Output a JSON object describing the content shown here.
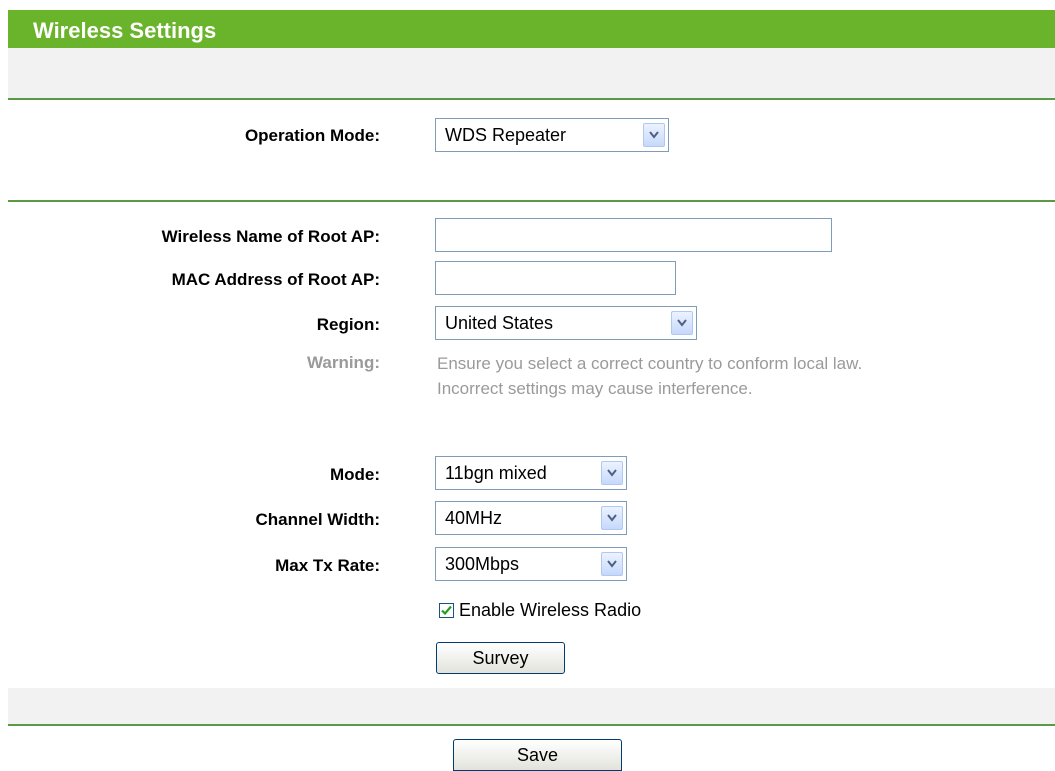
{
  "header": {
    "title": "Wireless Settings"
  },
  "operation_mode": {
    "label": "Operation Mode:",
    "value": "WDS Repeater"
  },
  "root_ap_name": {
    "label": "Wireless Name of Root AP:",
    "value": ""
  },
  "root_ap_mac": {
    "label": "MAC Address of Root AP:",
    "value": ""
  },
  "region": {
    "label": "Region:",
    "value": "United States"
  },
  "warning": {
    "label": "Warning:",
    "line1": "Ensure you select a correct country to conform local law.",
    "line2": "Incorrect settings may cause interference."
  },
  "mode": {
    "label": "Mode:",
    "value": "11bgn mixed"
  },
  "channel_width": {
    "label": "Channel Width:",
    "value": "40MHz"
  },
  "max_tx_rate": {
    "label": "Max Tx Rate:",
    "value": "300Mbps"
  },
  "enable_radio": {
    "label": "Enable Wireless Radio",
    "checked": true
  },
  "buttons": {
    "survey": "Survey",
    "save": "Save"
  },
  "colors": {
    "header_green": "#6ab42b",
    "rule_green": "#5a9a46",
    "warning_gray": "#9a9a9a"
  }
}
